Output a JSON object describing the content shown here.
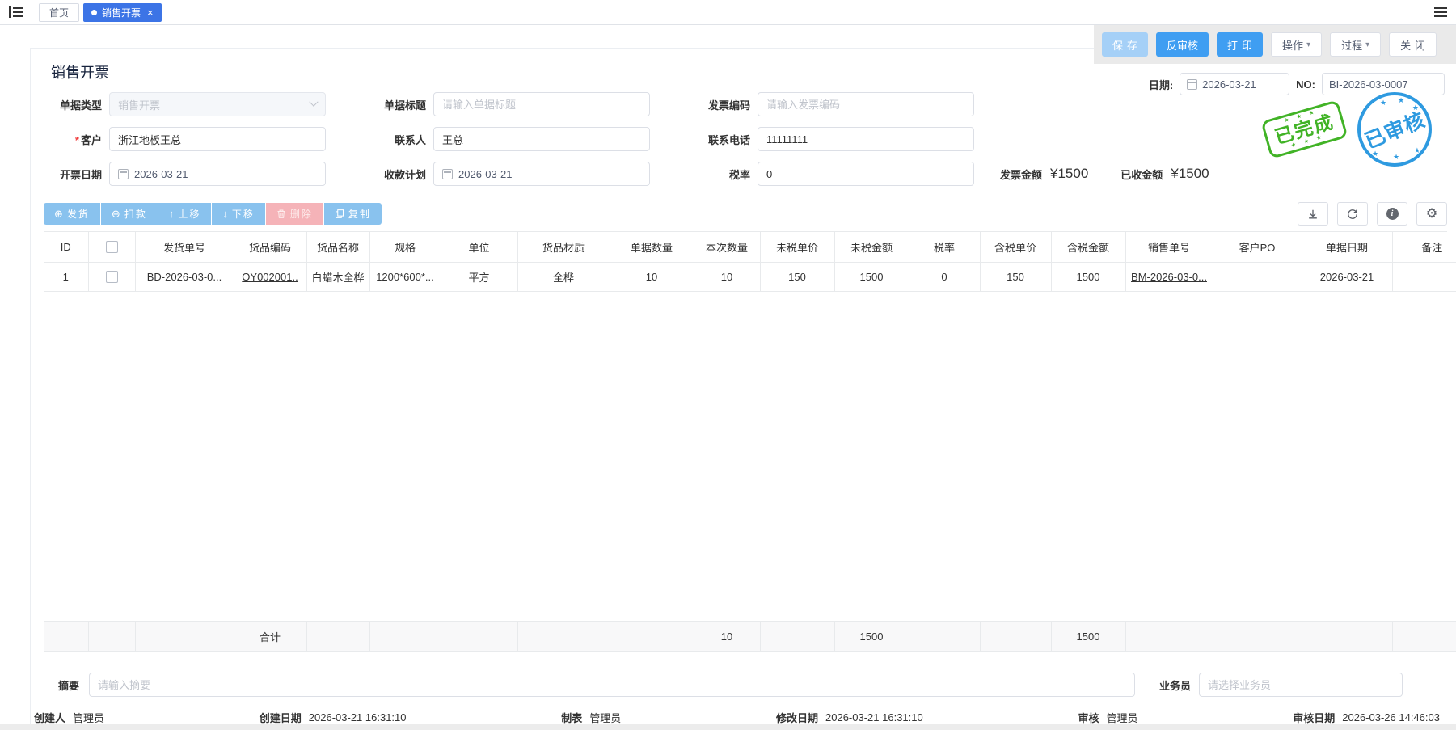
{
  "tabbar": {
    "home_tab": "首页",
    "active_tab": "销售开票",
    "close_glyph": "×",
    "dot_icon": "tab-active-dot"
  },
  "actionbar": {
    "save": "保存",
    "unaudit": "反审核",
    "print": "打印",
    "operate": "操作",
    "process": "过程",
    "close": "关闭",
    "caret": "▾"
  },
  "doc_header": {
    "date_label": "日期:",
    "date_value": "2026-03-21",
    "no_label": "NO:",
    "no_value": "BI-2026-03-0007"
  },
  "page_title": "销售开票",
  "form": {
    "doc_type": {
      "label": "单据类型",
      "value": "销售开票"
    },
    "doc_title": {
      "label": "单据标题",
      "placeholder": "请输入单据标题"
    },
    "invoice_code": {
      "label": "发票编码",
      "placeholder": "请输入发票编码"
    },
    "customer": {
      "label": "客户",
      "required": "*",
      "value": "浙江地板王总"
    },
    "contact": {
      "label": "联系人",
      "value": "王总"
    },
    "phone": {
      "label": "联系电话",
      "value": "11111111"
    },
    "invoice_date": {
      "label": "开票日期",
      "value": "2026-03-21"
    },
    "payment_plan": {
      "label": "收款计划",
      "value": "2026-03-21"
    },
    "tax_rate": {
      "label": "税率",
      "value": "0"
    }
  },
  "amounts": {
    "invoice_label": "发票金额",
    "invoice_value": "¥1500",
    "received_label": "已收金额",
    "received_value": "¥1500"
  },
  "stamps": {
    "completed": "已完成",
    "audited": "已审核",
    "completed_color": "#41b326",
    "audited_color": "#2e9ae0"
  },
  "grid_toolbar": {
    "ship": "发货",
    "deduct": "扣款",
    "move_up": "上移",
    "move_down": "下移",
    "delete": "删除",
    "copy": "复制",
    "plus_icon": "⊕",
    "minus_icon": "⊖",
    "up_icon": "↑",
    "down_icon": "↓"
  },
  "table": {
    "columns": [
      "ID",
      "",
      "发货单号",
      "货品编码",
      "货品名称",
      "规格",
      "单位",
      "货品材质",
      "单据数量",
      "本次数量",
      "未税单价",
      "未税金额",
      "税率",
      "含税单价",
      "含税金额",
      "销售单号",
      "客户PO",
      "单据日期",
      "备注"
    ],
    "rows": [
      [
        "1",
        "",
        "BD-2026-03-0...",
        "OY002001..",
        "白蜡木全桦",
        "1200*600*...",
        "平方",
        "全桦",
        "10",
        "10",
        "150",
        "1500",
        "0",
        "150",
        "1500",
        "BM-2026-03-0...",
        "",
        "2026-03-21",
        ""
      ]
    ],
    "totals": {
      "3": "合计",
      "9": "10",
      "11": "1500",
      "14": "1500"
    }
  },
  "summary": {
    "label": "摘要",
    "placeholder": "请输入摘要"
  },
  "salesman": {
    "label": "业务员",
    "placeholder": "请选择业务员"
  },
  "footer": [
    {
      "label": "创建人",
      "value": "管理员"
    },
    {
      "label": "创建日期",
      "value": "2026-03-21 16:31:10"
    },
    {
      "label": "制表",
      "value": "管理员"
    },
    {
      "label": "修改日期",
      "value": "2026-03-21 16:31:10"
    },
    {
      "label": "审核",
      "value": "管理员"
    },
    {
      "label": "审核日期",
      "value": "2026-03-26 14:46:03"
    }
  ],
  "colors": {
    "tab_blue": "#3c74e6",
    "primary_blue": "#3f9ef2",
    "toolbar_blue": "#89c2ee"
  }
}
